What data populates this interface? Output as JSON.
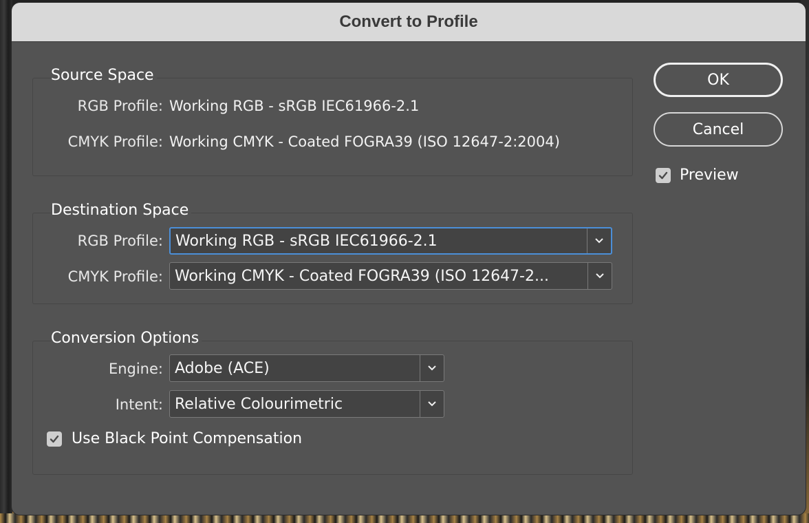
{
  "dialog": {
    "title": "Convert to Profile"
  },
  "source_space": {
    "title": "Source Space",
    "rgb_label": "RGB Profile:",
    "rgb_value": "Working RGB - sRGB IEC61966-2.1",
    "cmyk_label": "CMYK Profile:",
    "cmyk_value": "Working CMYK - Coated FOGRA39 (ISO 12647-2:2004)"
  },
  "destination_space": {
    "title": "Destination Space",
    "rgb_label": "RGB Profile:",
    "rgb_selected": "Working RGB - sRGB IEC61966-2.1",
    "cmyk_label": "CMYK Profile:",
    "cmyk_selected": "Working CMYK - Coated FOGRA39 (ISO 12647-2..."
  },
  "conversion_options": {
    "title": "Conversion Options",
    "engine_label": "Engine:",
    "engine_selected": "Adobe (ACE)",
    "intent_label": "Intent:",
    "intent_selected": "Relative Colourimetric",
    "black_point_label": "Use Black Point Compensation",
    "black_point_checked": true
  },
  "buttons": {
    "ok_label": "OK",
    "cancel_label": "Cancel"
  },
  "preview": {
    "label": "Preview",
    "checked": true
  },
  "icons": {
    "dropdown": "chevron-down-icon",
    "check": "checkmark-icon"
  },
  "colors": {
    "dialog_bg": "#535353",
    "titlebar_bg": "#d9d9d9",
    "focus_ring": "#4b8fd9"
  }
}
